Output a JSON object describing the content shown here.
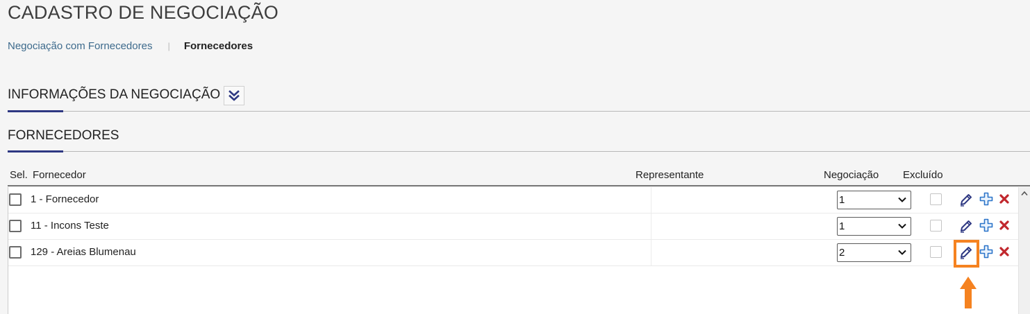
{
  "page": {
    "title": "CADASTRO DE NEGOCIAÇÃO"
  },
  "breadcrumb": {
    "link_label": "Negociação com Fornecedores",
    "separator": "|",
    "current_label": "Fornecedores"
  },
  "sections": {
    "info": {
      "title": "INFORMAÇÕES DA NEGOCIAÇÃO",
      "toggle_icon": "double-chevron-down-icon"
    },
    "fornecedores": {
      "title": "FORNECEDORES"
    }
  },
  "table": {
    "columns": {
      "sel": "Sel.",
      "fornecedor": "Fornecedor",
      "representante": "Representante",
      "negociacao": "Negociação",
      "excluido": "Excluído"
    },
    "rows": [
      {
        "fornecedor": "1 - Fornecedor",
        "representante": "",
        "negociacao": "1",
        "selected": false,
        "excluido": false
      },
      {
        "fornecedor": "11 - Incons Teste",
        "representante": "",
        "negociacao": "1",
        "selected": false,
        "excluido": false
      },
      {
        "fornecedor": "129 - Areias Blumenau",
        "representante": "",
        "negociacao": "2",
        "selected": false,
        "excluido": false
      }
    ],
    "row_actions": [
      "pencil-edit-icon",
      "plus-add-icon",
      "x-delete-icon"
    ]
  },
  "annotation": {
    "highlight_color": "#f58220",
    "target": "pencil-edit-icon (row 3)"
  },
  "colors": {
    "accent": "#2e3882",
    "link": "#3d6a8c",
    "icon_blue": "#2b74c9",
    "icon_red": "#c1272d"
  }
}
